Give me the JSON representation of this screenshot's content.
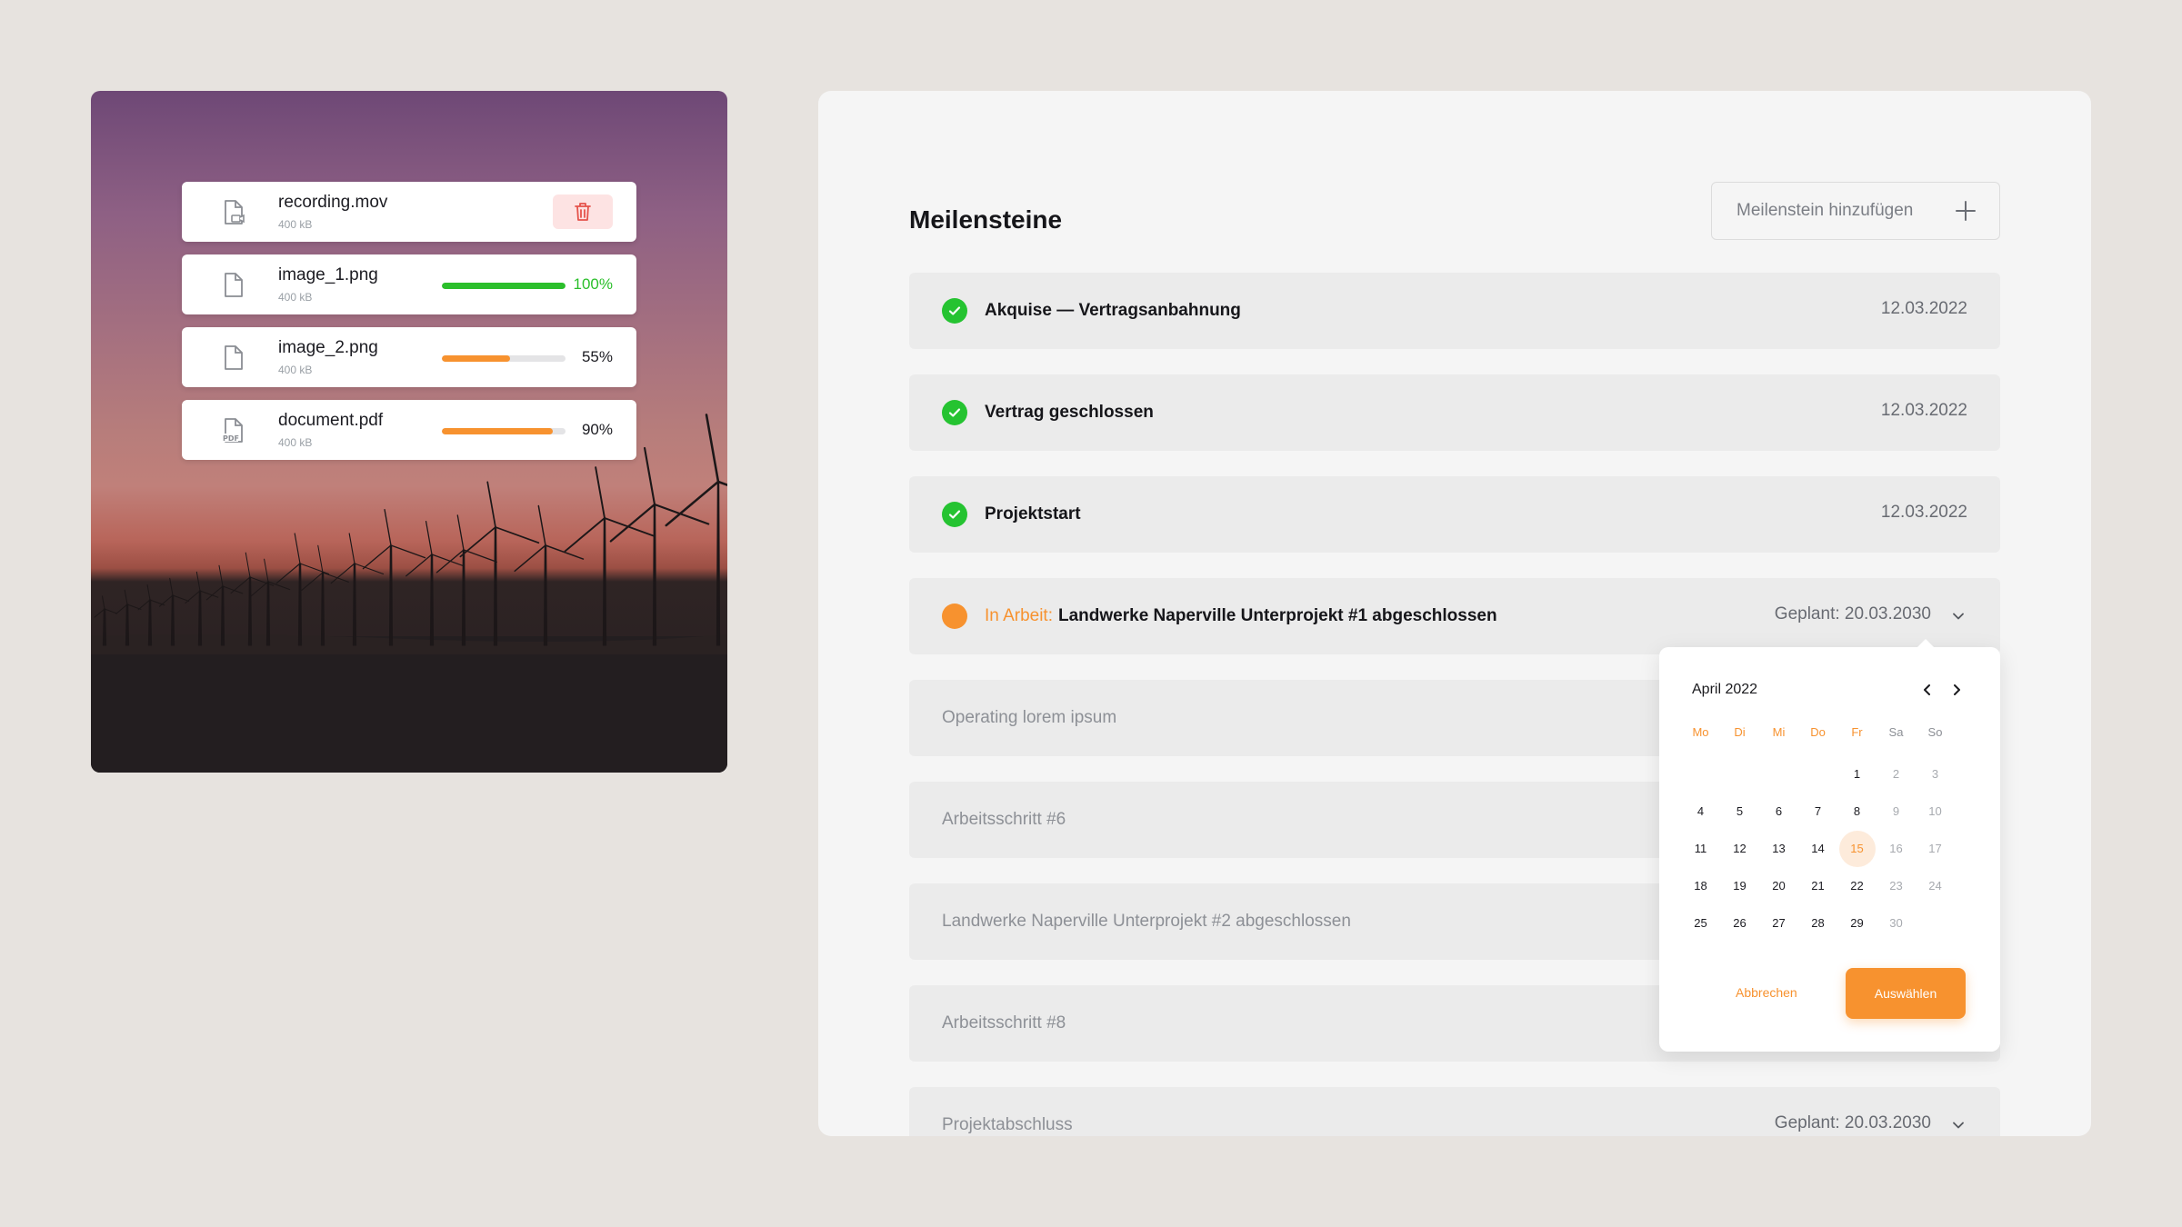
{
  "colors": {
    "accent": "#f7922f",
    "success": "#25c331",
    "danger": "#e5534b",
    "background": "#e7e3df"
  },
  "uploads": [
    {
      "name": "recording.mov",
      "size": "400 kB",
      "icon": "file-video-icon",
      "action": "delete"
    },
    {
      "name": "image_1.png",
      "size": "400 kB",
      "icon": "file-icon",
      "progress": 100,
      "progress_label": "100%",
      "color": "#2bbf2b"
    },
    {
      "name": "image_2.png",
      "size": "400 kB",
      "icon": "file-icon",
      "progress": 55,
      "progress_label": "55%",
      "color": "#f7922f"
    },
    {
      "name": "document.pdf",
      "size": "400 kB",
      "icon": "file-pdf-icon",
      "progress": 90,
      "progress_label": "90%",
      "color": "#f7922f"
    }
  ],
  "milestones_panel": {
    "title": "Meilensteine",
    "add_button": "Meilenstein hinzufügen",
    "items": [
      {
        "label": "Akquise — Vertragsanbahnung",
        "date": "12.03.2022",
        "status": "done"
      },
      {
        "label": "Vertrag geschlossen",
        "date": "12.03.2022",
        "status": "done"
      },
      {
        "label": "Projektstart",
        "date": "12.03.2022",
        "status": "done"
      },
      {
        "state": "In Arbeit:",
        "label": "Landwerke Naperville Unterprojekt #1 abgeschlossen",
        "date": "Geplant: 20.03.2030",
        "status": "in-progress"
      },
      {
        "label": "Operating lorem ipsum",
        "status": "open"
      },
      {
        "label": "Arbeitsschritt #6",
        "status": "open"
      },
      {
        "label": "Landwerke Naperville Unterprojekt #2 abgeschlossen",
        "status": "open"
      },
      {
        "label": "Arbeitsschritt #8",
        "status": "open"
      },
      {
        "label": "Projektabschluss",
        "date": "Geplant: 20.03.2030",
        "status": "open"
      }
    ]
  },
  "datepicker": {
    "month": "April 2022",
    "weekdays": [
      "Mo",
      "Di",
      "Mi",
      "Do",
      "Fr",
      "Sa",
      "So"
    ],
    "weeks": [
      [
        "",
        "",
        "",
        "",
        "1",
        "2",
        "3"
      ],
      [
        "4",
        "5",
        "6",
        "7",
        "8",
        "9",
        "10"
      ],
      [
        "11",
        "12",
        "13",
        "14",
        "15",
        "16",
        "17"
      ],
      [
        "18",
        "19",
        "20",
        "21",
        "22",
        "23",
        "24"
      ],
      [
        "25",
        "26",
        "27",
        "28",
        "29",
        "30",
        ""
      ]
    ],
    "selected": "15",
    "cancel": "Abbrechen",
    "confirm": "Auswählen"
  }
}
